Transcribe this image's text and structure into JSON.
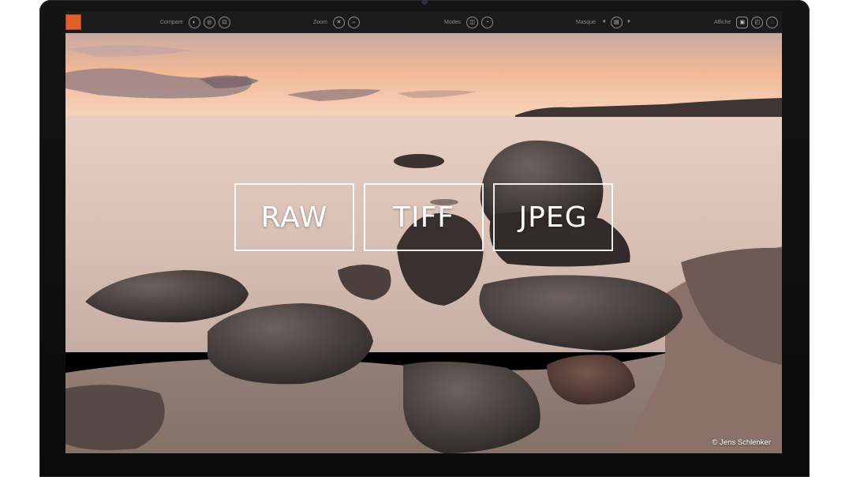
{
  "toolbar": {
    "groups": [
      {
        "label": "Compare",
        "buttons": [
          "◐",
          "◎",
          "⊡"
        ]
      },
      {
        "label": "Zoom",
        "buttons": [
          "✕",
          "⇔"
        ]
      },
      {
        "label": "Modes",
        "buttons": [
          "◫",
          "◔"
        ]
      },
      {
        "label": "Masque",
        "buttons": [
          "▤"
        ]
      },
      {
        "label": "Affiche",
        "buttons": [
          "▣",
          "◰",
          "◌"
        ]
      }
    ]
  },
  "overlay": {
    "formats": [
      "RAW",
      "TIFF",
      "JPEG"
    ]
  },
  "credit": "© Jens Schlenker",
  "colors": {
    "accent": "#e0602d",
    "toolbar_bg": "#1b1b1b",
    "bezel": "#111111"
  }
}
